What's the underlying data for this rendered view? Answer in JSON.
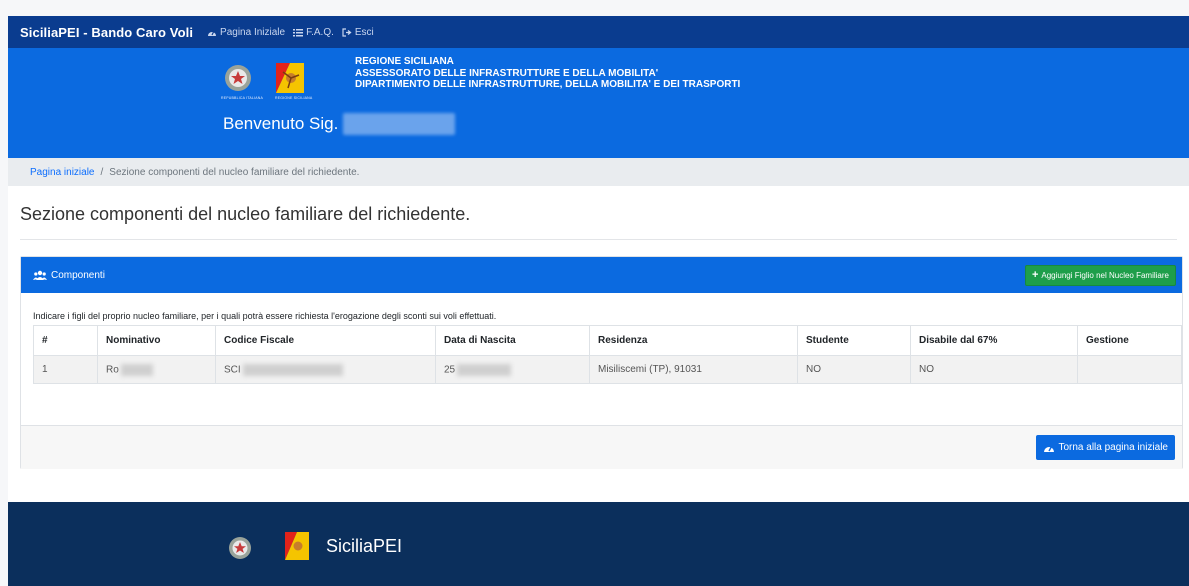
{
  "navbar": {
    "brand": "SiciliaPEI - Bando Caro Voli",
    "links": [
      {
        "label": "Pagina Iniziale",
        "icon": "dashboard-icon"
      },
      {
        "label": "F.A.Q.",
        "icon": "list-icon"
      },
      {
        "label": "Esci",
        "icon": "sign-out-icon"
      }
    ]
  },
  "header": {
    "emblem_left_caption": "REPUBBLICA ITALIANA",
    "emblem_right_caption": "REGIONE SICILIANA",
    "institution_lines": [
      "REGIONE SICILIANA",
      "ASSESSORATO DELLE INFRASTRUTTURE E DELLA MOBILITA'",
      "DIPARTIMENTO DELLE INFRASTRUTTURE, DELLA MOBILITA' E DEI TRASPORTI"
    ],
    "welcome": "Benvenuto Sig."
  },
  "breadcrumb": {
    "home": "Pagina iniziale",
    "separator": "/",
    "current": "Sezione componenti del nucleo familiare del richiedente."
  },
  "page_title": "Sezione componenti del nucleo familiare del richiedente.",
  "card": {
    "title": "Componenti",
    "add_button": "Aggiungi Figlio nel Nucleo Familiare",
    "intro": "Indicare i figli del proprio nucleo familiare, per i quali potrà essere richiesta l'erogazione degli sconti sui voli effettuati.",
    "columns": [
      "#",
      "Nominativo",
      "Codice Fiscale",
      "Data di Nascita",
      "Residenza",
      "Studente",
      "Disabile dal 67%",
      "Gestione"
    ],
    "rows": [
      {
        "num": "1",
        "nominativo": "Ro",
        "codice": "SCI",
        "nascita": "25",
        "residenza": "Misiliscemi (TP), 91031",
        "studente": "NO",
        "disabile": "NO",
        "gestione": ""
      }
    ],
    "back_button": "Torna alla pagina iniziale"
  },
  "footer": {
    "name": "SiciliaPEI"
  },
  "colors": {
    "navbar": "#0a3c8f",
    "header": "#0b6ae0",
    "footer": "#0b2f5c",
    "add_button": "#1e9e4a"
  }
}
